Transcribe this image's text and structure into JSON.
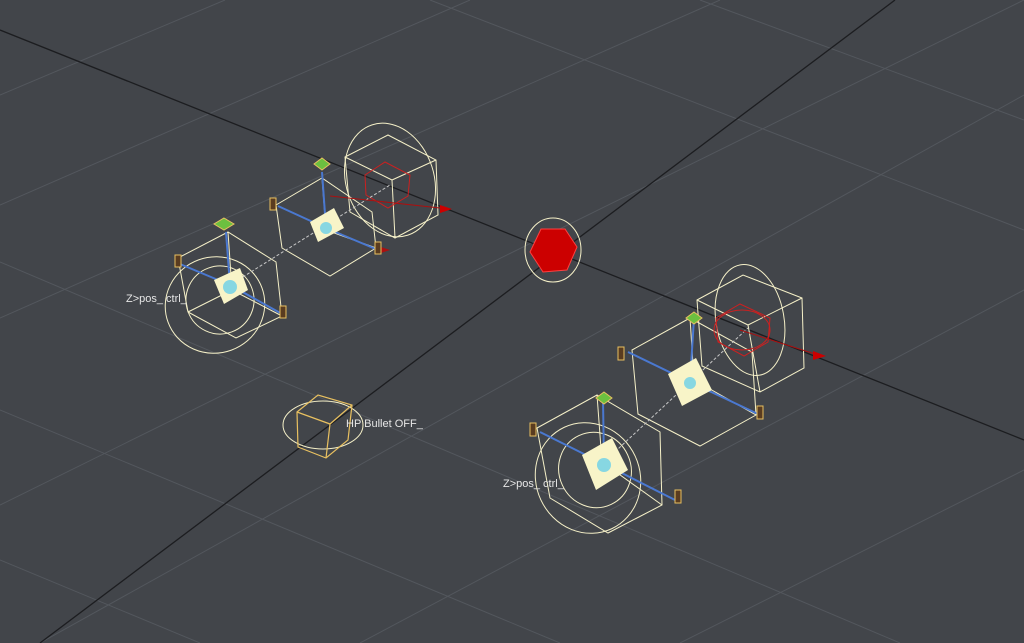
{
  "viewport": {
    "background": "#42454a",
    "grid_color": "#53575d",
    "axis_color": "#1a1a1a",
    "wire_color": "#f5f0c8",
    "selected_color": "#e8c060",
    "accent_red": "#cc0000"
  },
  "labels": {
    "ctrl_left": "Z>pos_ ctrl_",
    "ctrl_right": "Z>pos_ ctrl_",
    "hp_bullet": "HP Bullet OFF_"
  },
  "icons": {
    "root_null": "red-hexagon-null-icon",
    "handle": "cube-handle-icon",
    "locator": "green-diamond-locator-icon"
  }
}
